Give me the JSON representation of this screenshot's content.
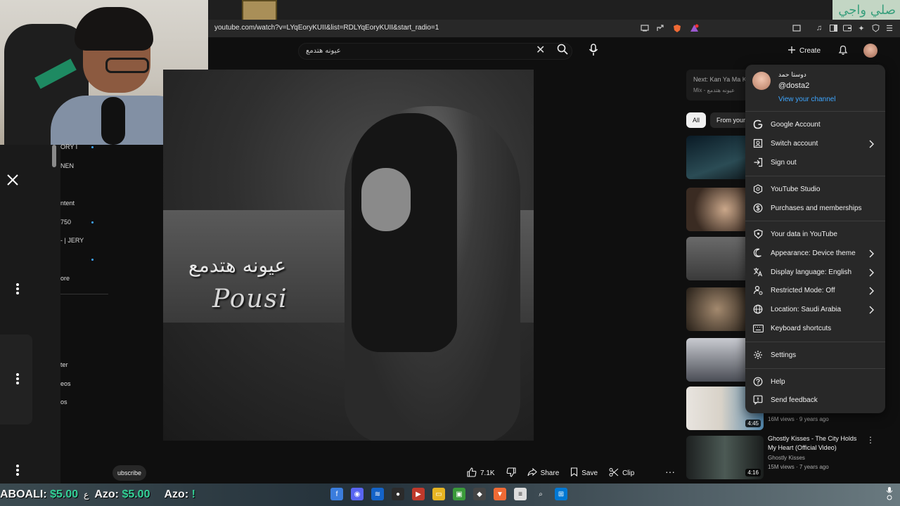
{
  "browser": {
    "url": "youtube.com/watch?v=LYqEoryKUII&list=RDLYqEoryKUII&start_radio=1",
    "watermark_text": "صلي واجي"
  },
  "masthead": {
    "search_value": "عيونه هتدمع",
    "create_label": "Create"
  },
  "guide": {
    "items": [
      "ORY I",
      "NEN",
      "ntent",
      "750",
      "- | JERY",
      "ore",
      "ter",
      "eos",
      "os"
    ],
    "subscribe_label": "ubscribe"
  },
  "video": {
    "overlay_title_ar": "عيونه هتدمع",
    "overlay_title_en": "Pousi",
    "likes": "7.1K",
    "share_label": "Share",
    "save_label": "Save",
    "clip_label": "Clip"
  },
  "sidebar": {
    "next_label": "Next: Kan Ya Ma K",
    "next_sub": "Mix - عيونه هتدمع",
    "chips": [
      "All",
      "From your"
    ],
    "recommendations": [
      {
        "duration": ""
      },
      {
        "duration": ""
      },
      {
        "duration": ""
      },
      {
        "duration": ""
      },
      {
        "duration": ""
      },
      {
        "duration": "4:45",
        "meta": "16M views · 9 years ago"
      },
      {
        "duration": "4:16",
        "title": "Ghostly Kisses - The City Holds My Heart (Official Video)",
        "channel": "Ghostly Kisses",
        "meta": "15M views · 7 years ago"
      }
    ]
  },
  "account_menu": {
    "display_name": "دوستا حمد",
    "handle": "@dosta2",
    "view_channel": "View your channel",
    "items": [
      {
        "label": "Google Account",
        "icon": "google-icon",
        "chevron": false
      },
      {
        "label": "Switch account",
        "icon": "switch-account-icon",
        "chevron": true
      },
      {
        "label": "Sign out",
        "icon": "sign-out-icon",
        "chevron": false
      },
      {
        "label": "YouTube Studio",
        "icon": "studio-icon",
        "chevron": false
      },
      {
        "label": "Purchases and memberships",
        "icon": "dollar-icon",
        "chevron": false
      },
      {
        "label": "Your data in YouTube",
        "icon": "shield-icon",
        "chevron": false
      },
      {
        "label": "Appearance: Device theme",
        "icon": "moon-icon",
        "chevron": true
      },
      {
        "label": "Display language: English",
        "icon": "translate-icon",
        "chevron": true
      },
      {
        "label": "Restricted Mode: Off",
        "icon": "restricted-icon",
        "chevron": true
      },
      {
        "label": "Location: Saudi Arabia",
        "icon": "globe-icon",
        "chevron": true
      },
      {
        "label": "Keyboard shortcuts",
        "icon": "keyboard-icon",
        "chevron": false
      },
      {
        "label": "Settings",
        "icon": "gear-icon",
        "chevron": false
      },
      {
        "label": "Help",
        "icon": "help-icon",
        "chevron": false
      },
      {
        "label": "Send feedback",
        "icon": "feedback-icon",
        "chevron": false
      }
    ]
  },
  "taskbar": {
    "ticker_1_name": "ABOALI:",
    "ticker_1_amount": "$5.00",
    "ticker_sep": "ع",
    "ticker_2_name": "Azo:",
    "ticker_2_amount": "$5.00",
    "ticker_3_name": "Azo:",
    "ticker_3_amount": "!"
  },
  "colors": {
    "accent_link": "#3ea6ff",
    "ticker_amount": "#34d399",
    "menu_bg": "#282828",
    "page_bg": "#0f0f0f"
  }
}
